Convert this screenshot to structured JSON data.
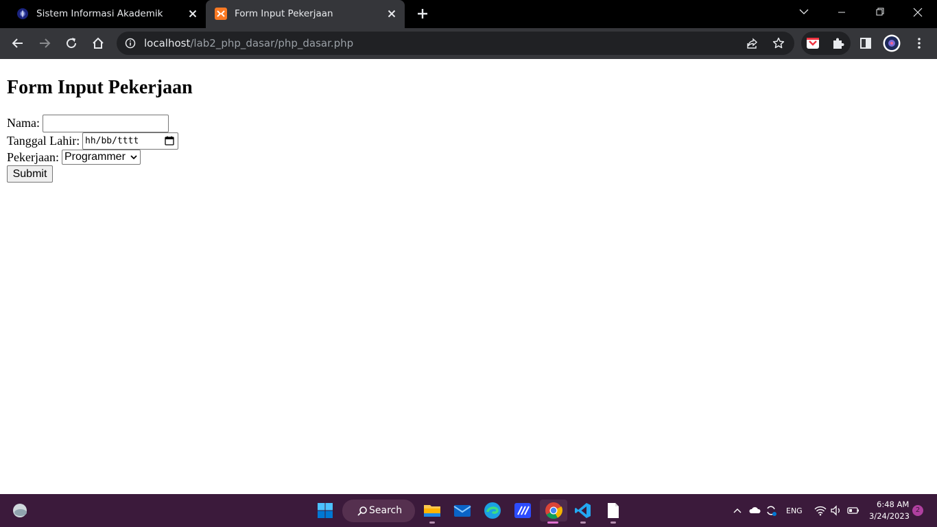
{
  "browser": {
    "tabs": [
      {
        "title": "Sistem Informasi Akademik",
        "active": false,
        "icon": "university-logo-icon"
      },
      {
        "title": "Form Input Pekerjaan",
        "active": true,
        "icon": "xampp-icon"
      }
    ],
    "url_host": "localhost",
    "url_path": "/lab2_php_dasar/php_dasar.php"
  },
  "page": {
    "heading": "Form Input Pekerjaan",
    "nama_label": "Nama:",
    "nama_value": "",
    "tanggal_label": "Tanggal Lahir:",
    "tanggal_placeholder": "hh/bb/tttt",
    "pekerjaan_label": "Pekerjaan:",
    "pekerjaan_selected": "Programmer",
    "submit_label": "Submit"
  },
  "taskbar": {
    "search_label": "Search",
    "language": "ENG",
    "time": "6:48 AM",
    "date": "3/24/2023",
    "notification_count": "2"
  },
  "colors": {
    "tabstrip": "#000000",
    "toolbar": "#35363a",
    "omnibox": "#202124",
    "taskbar": "#3b1a3b",
    "xampp_orange": "#fb7a24"
  }
}
